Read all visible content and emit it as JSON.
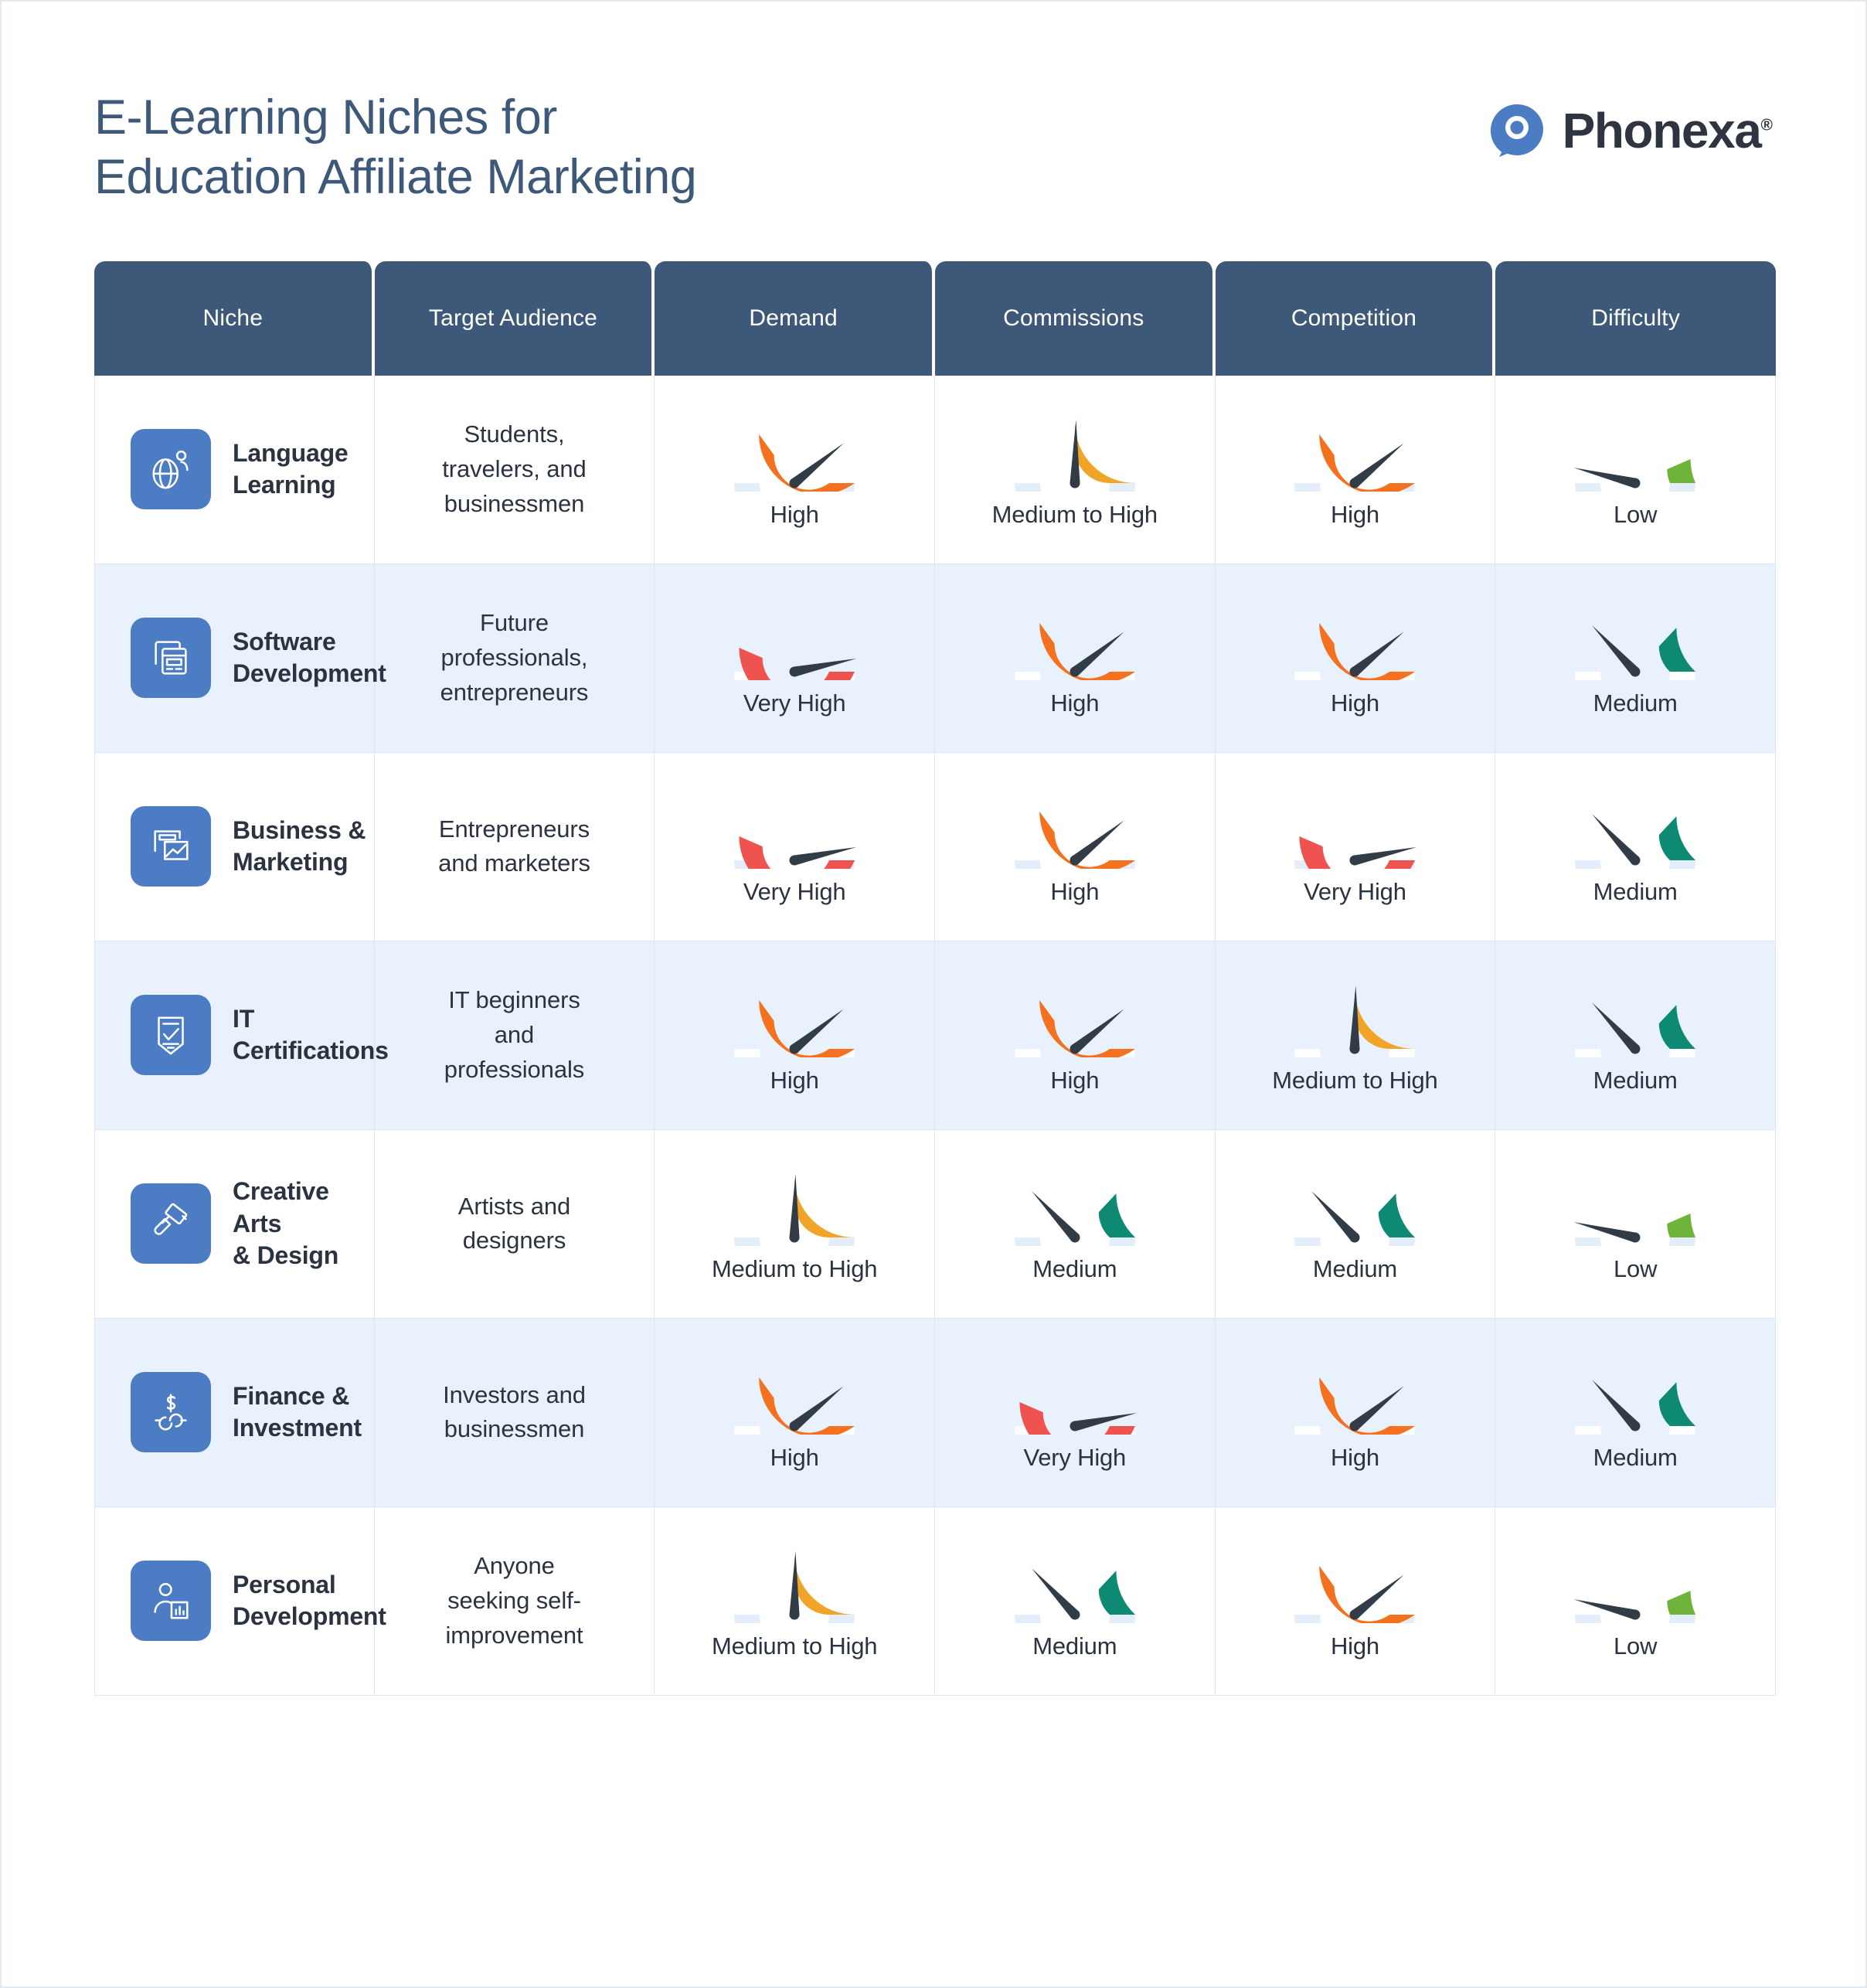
{
  "title": "E-Learning Niches for\nEducation Affiliate Marketing",
  "brand": {
    "name": "Phonexa",
    "registered": "®",
    "mark_color": "#4b7cc4",
    "text_color": "#2e3440"
  },
  "colors": {
    "header_bg": "#3d5878",
    "alt_row_bg": "#e9f2fc",
    "icon_tile": "#4b7cc4",
    "needle": "#323c46",
    "track_light": "#e4eefb",
    "track_on_alt": "#ffffff",
    "very_high": "#ef5350",
    "high": "#f4711f",
    "medium_to_high": "#f0a428",
    "medium": "#0e8a74",
    "low": "#6fb33b"
  },
  "gauge_levels": {
    "Very High": {
      "fill": 0.87,
      "color": "#ef5350",
      "needle_deg": 168
    },
    "High": {
      "fill": 0.7,
      "color": "#f4711f",
      "needle_deg": 141
    },
    "Medium to High": {
      "fill": 0.5,
      "color": "#f0a428",
      "needle_deg": 91
    },
    "Medium": {
      "fill": 0.26,
      "color": "#0e8a74",
      "needle_deg": 47
    },
    "Low": {
      "fill": 0.13,
      "color": "#6fb33b",
      "needle_deg": 14
    }
  },
  "table": {
    "columns": [
      "Niche",
      "Target Audience",
      "Demand",
      "Commissions",
      "Competition",
      "Difficulty"
    ],
    "rows": [
      {
        "niche": "Language\nLearning",
        "icon": "globe-person-icon",
        "audience": "Students,\ntravelers, and\nbusinessmen",
        "demand": "High",
        "commissions": "Medium to High",
        "competition": "High",
        "difficulty": "Low"
      },
      {
        "niche": "Software\nDevelopment",
        "icon": "code-windows-icon",
        "audience": "Future\nprofessionals,\nentrepreneurs",
        "demand": "Very High",
        "commissions": "High",
        "competition": "High",
        "difficulty": "Medium"
      },
      {
        "niche": "Business &\nMarketing",
        "icon": "presentation-chart-icon",
        "audience": "Entrepreneurs\nand marketers",
        "demand": "Very High",
        "commissions": "High",
        "competition": "Very High",
        "difficulty": "Medium"
      },
      {
        "niche": "IT\nCertifications",
        "icon": "certificate-shield-check-icon",
        "audience": "IT beginners\nand\nprofessionals",
        "demand": "High",
        "commissions": "High",
        "competition": "Medium to High",
        "difficulty": "Medium"
      },
      {
        "niche": "Creative Arts\n& Design",
        "icon": "paint-brush-icon",
        "audience": "Artists and\ndesigners",
        "demand": "Medium to High",
        "commissions": "Medium",
        "competition": "Medium",
        "difficulty": "Low"
      },
      {
        "niche": "Finance &\nInvestment",
        "icon": "dollar-exchange-icon",
        "audience": "Investors and\nbusinessmen",
        "demand": "High",
        "commissions": "Very High",
        "competition": "High",
        "difficulty": "Medium"
      },
      {
        "niche": "Personal\nDevelopment",
        "icon": "person-growth-chart-icon",
        "audience": "Anyone\nseeking self-\nimprovement",
        "demand": "Medium to High",
        "commissions": "Medium",
        "competition": "High",
        "difficulty": "Low"
      }
    ]
  }
}
